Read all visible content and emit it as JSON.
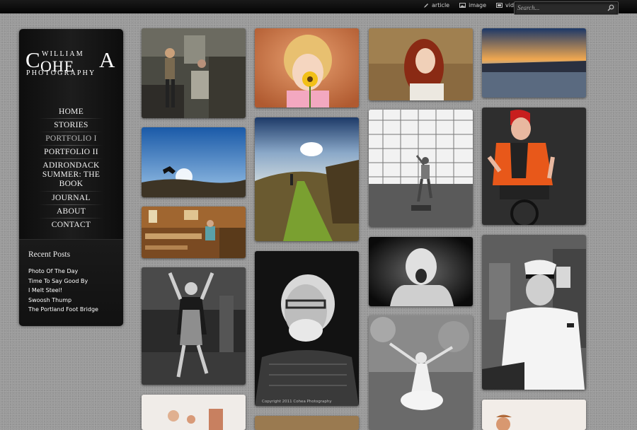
{
  "topnav": {
    "items": [
      {
        "label": "article",
        "icon": "pencil-icon"
      },
      {
        "label": "image",
        "icon": "image-icon"
      },
      {
        "label": "video",
        "icon": "video-icon"
      }
    ],
    "search_placeholder": "Search..."
  },
  "logo": {
    "letter_c": "C",
    "letters_ohe": "OHE",
    "letter_a": "A",
    "first_name": "WILLIAM",
    "tagline": "PHOTOGRAPHY"
  },
  "menu": {
    "items": [
      {
        "label": "HOME"
      },
      {
        "label": "STORIES"
      },
      {
        "label": "PORTFOLIO I",
        "active": true
      },
      {
        "label": "PORTFOLIO II"
      },
      {
        "label": "ADIRONDACK SUMMER: THE BOOK"
      },
      {
        "label": "JOURNAL"
      },
      {
        "label": "ABOUT"
      },
      {
        "label": "CONTACT"
      }
    ]
  },
  "recent_posts": {
    "title": "Recent Posts",
    "items": [
      "Photo Of The Day",
      "Time To Say Good By",
      "I Melt Steel!",
      "Swoosh Thump",
      "The Portland Foot Bridge"
    ]
  },
  "gallery": {
    "copyright": "Copyright 2011 Cohea Photography"
  },
  "colors": {
    "page_bg": "#9a9a9a",
    "sidebar_bg": "#141414",
    "topbar_bg": "#0a0a0a",
    "menu_text": "#f3f3f3",
    "menu_active": "#b8b8b8"
  }
}
